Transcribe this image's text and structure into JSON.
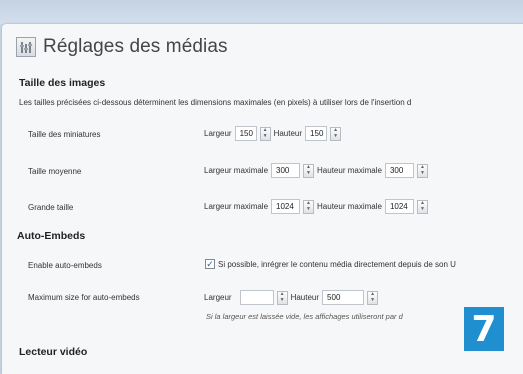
{
  "page": {
    "title": "Réglages des médias"
  },
  "images": {
    "heading": "Taille des images",
    "description": "Les tailles précisées ci-dessous déterminent les dimensions maximales (en pixels) à utiliser lors de l'insertion d",
    "thumb": {
      "label": "Taille des miniatures",
      "width_label": "Largeur",
      "width_value": "150",
      "height_label": "Hauteur",
      "height_value": "150"
    },
    "medium": {
      "label": "Taille moyenne",
      "width_label": "Largeur maximale",
      "width_value": "300",
      "height_label": "Hauteur maximale",
      "height_value": "300"
    },
    "large": {
      "label": "Grande taille",
      "width_label": "Largeur maximale",
      "width_value": "1024",
      "height_label": "Hauteur maximale",
      "height_value": "1024"
    }
  },
  "embeds": {
    "heading": "Auto-Embeds",
    "enable_label": "Enable auto-embeds",
    "enable_checked": true,
    "enable_text": "Si possible, inrégrer le contenu média directement depuis de son U",
    "maxsize_label": "Maximum size for auto-embeds",
    "width_label": "Largeur",
    "width_value": "",
    "height_label": "Hauteur",
    "height_value": "500",
    "note": "Si la largeur est laissée vide, les affichages utiliseront par d"
  },
  "video": {
    "heading": "Lecteur vidéo"
  },
  "badge": {
    "number": "7",
    "color": "#1f8fd0"
  }
}
